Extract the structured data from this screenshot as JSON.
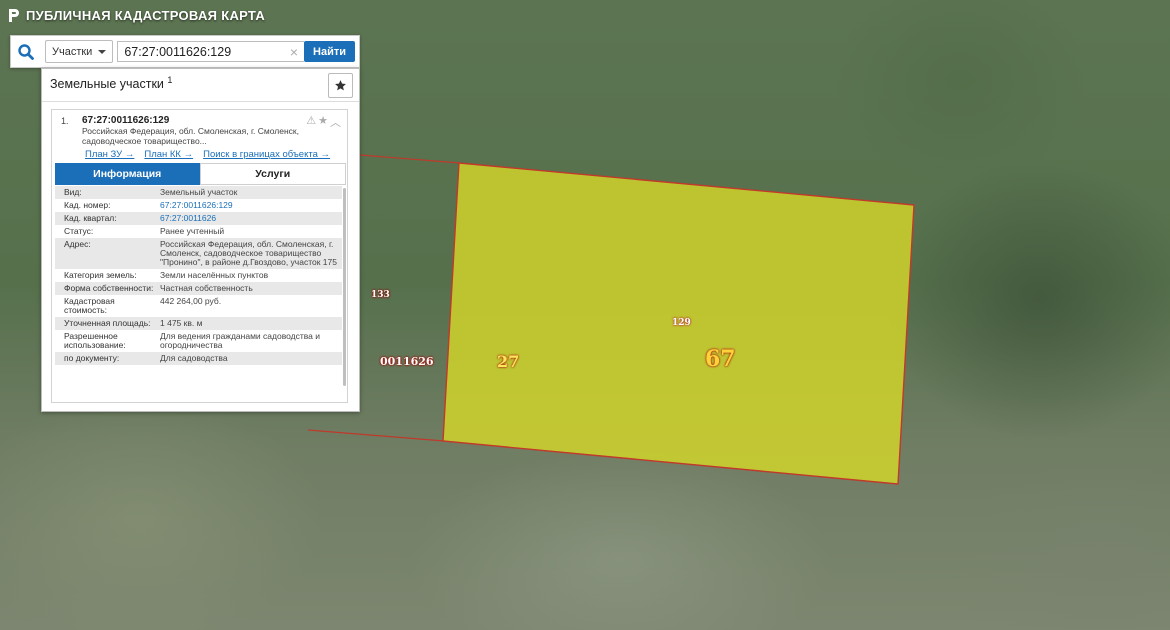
{
  "brand": {
    "title": "ПУБЛИЧНАЯ КАДАСТРОВАЯ КАРТА"
  },
  "search": {
    "type_label": "Участки",
    "query": "67:27:0011626:129",
    "find_label": "Найти"
  },
  "results": {
    "title": "Земельные участки",
    "count": "1",
    "item": {
      "index": "1.",
      "id": "67:27:0011626:129",
      "address_short": "Российская Федерация, обл. Смоленская, г. Смоленск, садоводческое товарищество...",
      "links": [
        "План ЗУ →",
        "План КК →",
        "Поиск в границах объекта →"
      ],
      "tabs": [
        "Информация",
        "Услуги"
      ],
      "rows": [
        {
          "k": "Вид:",
          "v": "Земельный участок"
        },
        {
          "k": "Кад. номер:",
          "v": "67:27:0011626:129",
          "link": true
        },
        {
          "k": "Кад. квартал:",
          "v": "67:27:0011626",
          "link": true
        },
        {
          "k": "Статус:",
          "v": "Ранее учтенный"
        },
        {
          "k": "Адрес:",
          "v": "Российская Федерация, обл. Смоленская, г. Смоленск, садоводческое товарищество \"Пронино\", в районе д.Гвоздово, участок 175"
        },
        {
          "k": "Категория земель:",
          "v": "Земли населённых пунктов"
        },
        {
          "k": "Форма собственности:",
          "v": "Частная собственность"
        },
        {
          "k": "Кадастровая стоимость:",
          "v": "442 264,00 руб."
        },
        {
          "k": "Уточненная площадь:",
          "v": "1 475 кв. м"
        },
        {
          "k": "Разрешенное использование:",
          "v": "Для ведения гражданами садоводства и огородничества"
        },
        {
          "k": "по документу:",
          "v": "Для садоводства"
        }
      ]
    }
  },
  "map": {
    "labels": {
      "parcel_133": "133",
      "quarter": "0011626",
      "district": "27",
      "parcel_129": "129",
      "region": "67"
    },
    "colors": {
      "parcel_fill": "#d4d72a",
      "parcel_border": "#c0392b",
      "accent": "#1a6fb8"
    }
  }
}
